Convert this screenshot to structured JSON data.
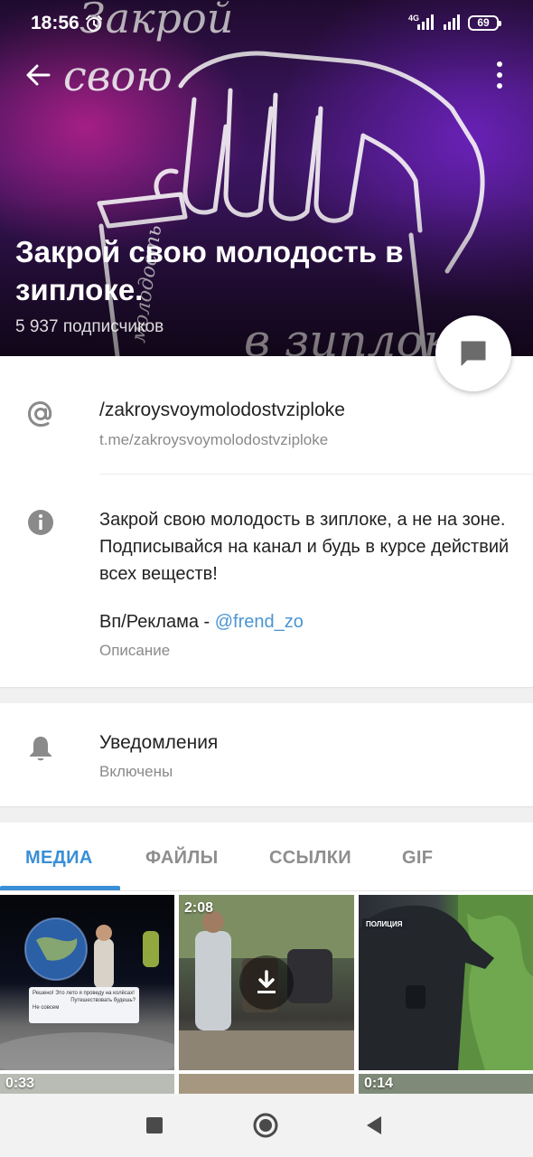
{
  "status_bar": {
    "time": "18:56",
    "network": "4G",
    "battery": "69"
  },
  "header": {
    "title": "Закрой свою молодость в зиплоке.",
    "subscribers": "5 937 подписчиков",
    "background_colors": [
      "#2a0f3e",
      "#3b1560",
      "#ff28aa",
      "#8228e6"
    ]
  },
  "link_row": {
    "username": "/zakroysvoymolodostvziploke",
    "url": "t.me/zakroysvoymolodostvziploke",
    "icon": "at-sign-icon"
  },
  "description_row": {
    "text": "Закрой свою молодость в зиплоке, а не на зоне. Подписывайся на канал и будь в курсе действий всех веществ!",
    "ad_prefix": "Вп/Реклама - ",
    "ad_link": "@frend_zo",
    "label": "Описание",
    "icon": "info-icon"
  },
  "notifications_row": {
    "title": "Уведомления",
    "status": "Включены",
    "icon": "bell-icon"
  },
  "tabs": [
    {
      "label": "МЕДИА",
      "active": true
    },
    {
      "label": "ФАЙЛЫ",
      "active": false
    },
    {
      "label": "ССЫЛКИ",
      "active": false
    },
    {
      "label": "GIF",
      "active": false
    }
  ],
  "media": {
    "items": [
      {
        "duration": ""
      },
      {
        "duration": "2:08"
      },
      {
        "duration": ""
      },
      {
        "duration": "0:33"
      },
      {
        "duration": ""
      },
      {
        "duration": "0:14"
      }
    ],
    "chat_card": {
      "line1": "Решено! Это лето я проведу на колёсах!",
      "line2": "Путешествовать будешь?",
      "line3": "Не совсем",
      "time": "13:21"
    },
    "police_label": "ПОЛИЦИЯ"
  },
  "colors": {
    "accent": "#3a8fd6",
    "link": "#4a95d4",
    "secondary_text": "#8a8a8a"
  }
}
